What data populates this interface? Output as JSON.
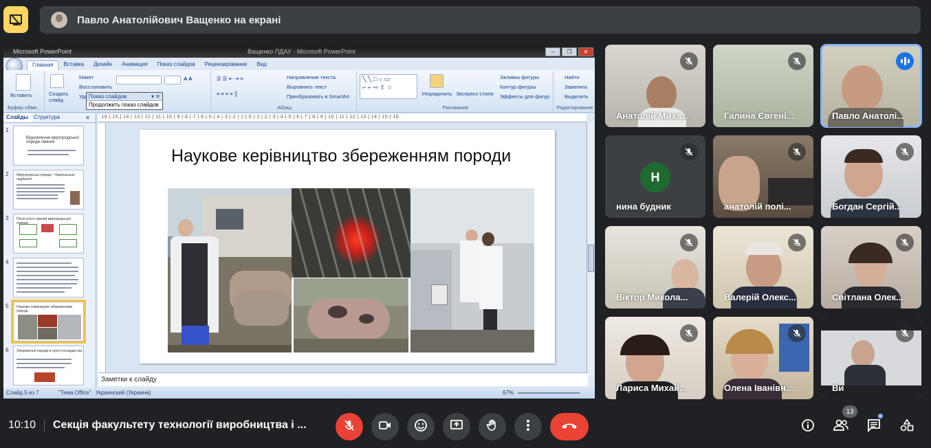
{
  "presenter_banner": {
    "text": "Павло Анатолійович Ващенко на екрані"
  },
  "powerpoint": {
    "app_title": "Microsoft PowerPoint",
    "doc_title": "Ващенко ПДАУ - Microsoft PowerPoint",
    "tabs": [
      "Главная",
      "Вставка",
      "Дизайн",
      "Анимация",
      "Показ слайдов",
      "Рецензирование",
      "Вид"
    ],
    "ribbon": {
      "paste": "Вставить",
      "clipboard": "Буфер обме...",
      "create_slide": "Создать слайд",
      "layout": "Макет",
      "restore": "Восстановить",
      "delete": "Удалить",
      "slides_group": "Слайды",
      "paragraph_group": "Абзац",
      "text_direction": "Направление текста",
      "align_text": "Выровнять текст",
      "convert_smartart": "Преобразовать в SmartArt",
      "arrange": "Упорядочить",
      "quick_styles": "Экспресс-стили",
      "drawing_group": "Рисование",
      "shape_fill": "Заливка фигуры",
      "shape_outline": "Контур фигуры",
      "shape_effects": "Эффекты для фигур",
      "find": "Найти",
      "replace": "Заменить",
      "select": "Выделить",
      "editing_group": "Редактирование"
    },
    "slideshow_popup": {
      "title": "Показ слайдов",
      "item": "Продолжить показ слайдов"
    },
    "left_pane": {
      "tab_slides": "Слайды",
      "tab_outline": "Структура",
      "thumbs": [
        {
          "num": "1",
          "text": "Відновлення миргородської породи свиней"
        },
        {
          "num": "2",
          "text": "Миргородська порода - Національне надбання"
        },
        {
          "num": "3",
          "text": "Після м'ясо свиней миргородської породи"
        },
        {
          "num": "4",
          "text": ""
        },
        {
          "num": "5",
          "text": "Наукове керівництво збереженням породи"
        },
        {
          "num": "6",
          "text": "Збереження породи в групі господарства"
        }
      ]
    },
    "ruler_text": "·16·|·15·|·14·|·13·|·12·|·11·|·10·|·9·|·8·|·7·|·6·|·5·|·4·|·3·|·2·|·1·|·0·|·1·|·2·|·3·|·4·|·5·|·6·|·7·|·8·|·9·|·10·|·11·|·12·|·13·|·14·|·15·|·16·",
    "slide_title": "Наукове керівництво збереженням породи",
    "notes_placeholder": "Заметки к слайду",
    "status": {
      "slide": "Слайд 5 из 7",
      "theme": "\"Тема Office\"",
      "language": "Украинский (Украина)",
      "zoom": "67%"
    }
  },
  "participants": [
    {
      "name": "Анатолій Миха...",
      "muted": true
    },
    {
      "name": "Галина Євгені...",
      "muted": true
    },
    {
      "name": "Павло Анатолі...",
      "muted": false,
      "speaking": true
    },
    {
      "name": "нина будник",
      "muted": true,
      "initial": "Н"
    },
    {
      "name": "анатолій полі...",
      "muted": true
    },
    {
      "name": "Богдан Сергій...",
      "muted": true
    },
    {
      "name": "Віктор Микола...",
      "muted": true
    },
    {
      "name": "Валерій Олекс...",
      "muted": true
    },
    {
      "name": "Світлана Олек...",
      "muted": true
    },
    {
      "name": "Лариса Михай...",
      "muted": true
    },
    {
      "name": "Олена Іванівн...",
      "muted": true
    },
    {
      "name": "Ви",
      "muted": true
    }
  ],
  "bottom": {
    "time": "10:10",
    "meeting_name": "Секція факультету технології виробництва і ...",
    "people_count": "13"
  },
  "colors": {
    "accent": "#8ab4f8",
    "end_call": "#ea4335",
    "presenting": "#fdd663",
    "avatar_green": "#1e6a30"
  }
}
